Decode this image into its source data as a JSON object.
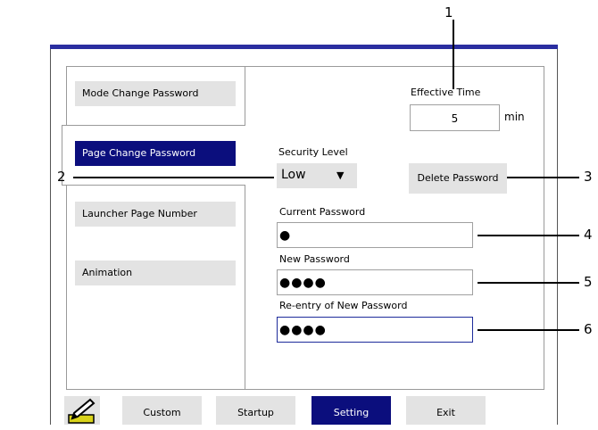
{
  "tabs": [
    {
      "label": "Mode Change Password"
    },
    {
      "label": "Page Change Password"
    },
    {
      "label": "Launcher Page Number"
    },
    {
      "label": "Animation"
    }
  ],
  "effective_time": {
    "label": "Effective Time",
    "value": "5",
    "unit": "min"
  },
  "security_level": {
    "label": "Security Level",
    "value": "Low"
  },
  "delete_password": {
    "label": "Delete Password"
  },
  "current_password": {
    "label": "Current Password",
    "value": "●"
  },
  "new_password": {
    "label": "New Password",
    "value": "●●●●"
  },
  "reentry_password": {
    "label": "Re-entry of New Password",
    "value": "●●●●"
  },
  "bottom_nav": [
    "Custom",
    "Startup",
    "Setting",
    "Exit"
  ],
  "callouts": [
    "1",
    "2",
    "3",
    "4",
    "5",
    "6"
  ],
  "colors": {
    "accent": "#0b0e7d",
    "frame_top": "#2a2ea0",
    "button_bg": "#e3e3e3"
  },
  "icons": {
    "edit": "pencil-edit-icon"
  }
}
